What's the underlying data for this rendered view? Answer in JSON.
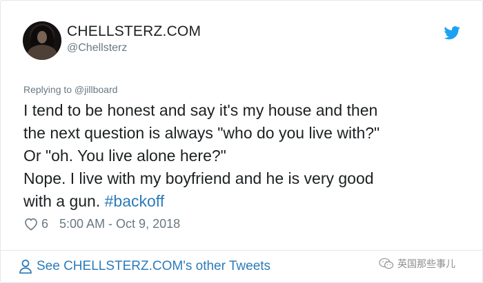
{
  "author": {
    "display_name": "CHELLSTERZ.COM",
    "handle": "@Chellsterz",
    "avatar_icon": "profile-photo"
  },
  "brand": {
    "icon": "twitter-bird-icon",
    "color": "#1da1f2"
  },
  "tweet": {
    "replying_to": "Replying to @jillboard",
    "lines": [
      "I tend to be honest and say it's my house and then",
      "the next question is always \"who do you live with?\"",
      "Or \"oh. You live alone here?\"",
      "Nope. I live with my boyfriend and he is very good"
    ],
    "last_line_text": "with a gun. ",
    "hashtag": "#backoff",
    "likes": "6",
    "timestamp": "5:00 AM - Oct 9, 2018"
  },
  "footer": {
    "link_label": "See CHELLSTERZ.COM's other Tweets"
  },
  "watermark": {
    "text": "英国那些事儿"
  },
  "colors": {
    "text": "#1c2022",
    "secondary": "#697882",
    "link": "#2b7bb9",
    "border": "#e1e8ed"
  }
}
